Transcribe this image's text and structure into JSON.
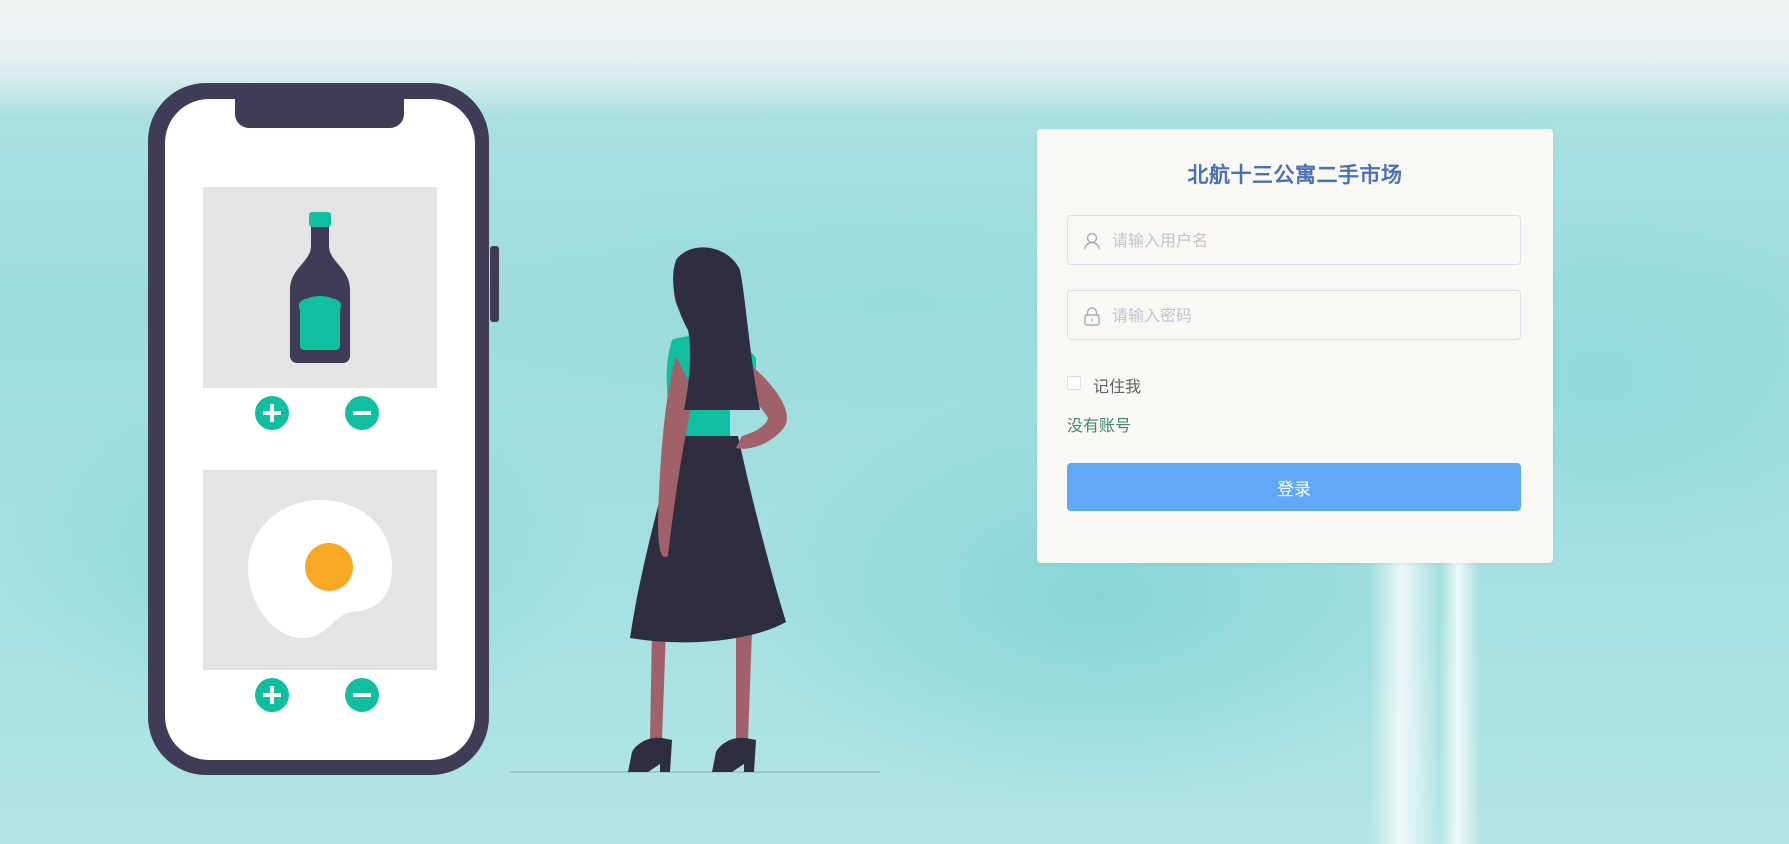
{
  "login": {
    "title": "北航十三公寓二手市场",
    "username_placeholder": "请输入用户名",
    "username_value": "",
    "password_placeholder": "请输入密码",
    "password_value": "",
    "remember_label": "记住我",
    "remember_checked": false,
    "register_link": "没有账号",
    "submit_label": "登录"
  },
  "icons": {
    "username": "user-icon",
    "password": "lock-icon",
    "plus": "plus-icon",
    "minus": "minus-icon"
  },
  "colors": {
    "title": "#4a72b0",
    "primary_button": "#5ea8f6",
    "link": "#3e8a6a",
    "card_background": "#faf8f4",
    "accent_teal": "#10bfa0",
    "phone_frame": "#3f3d56"
  }
}
